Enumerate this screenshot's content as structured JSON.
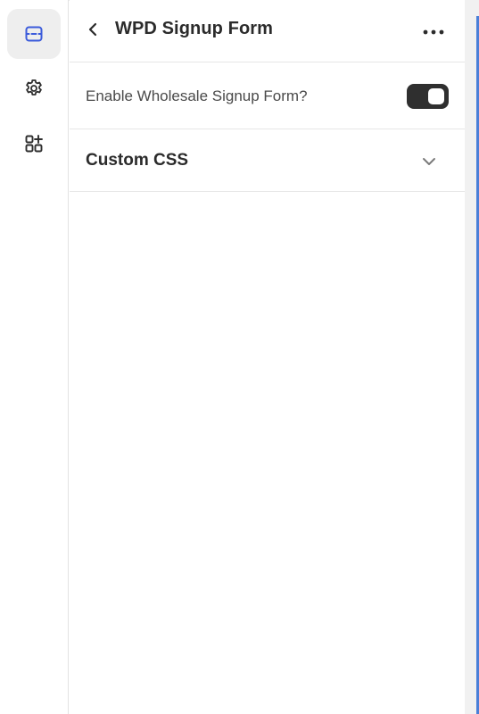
{
  "rail": {
    "items": [
      {
        "icon": "sections-icon",
        "active": true
      },
      {
        "icon": "gear-icon",
        "active": false
      },
      {
        "icon": "apps-add-icon",
        "active": false
      }
    ],
    "active_color": "#3b5bdb"
  },
  "header": {
    "title": "WPD Signup Form"
  },
  "settings": {
    "enable_signup_label": "Enable Wholesale Signup Form?",
    "enable_signup_value": true,
    "custom_css_label": "Custom CSS"
  },
  "colors": {
    "toggle_on": "#2f2f2f",
    "accent": "#4a7fd8"
  }
}
